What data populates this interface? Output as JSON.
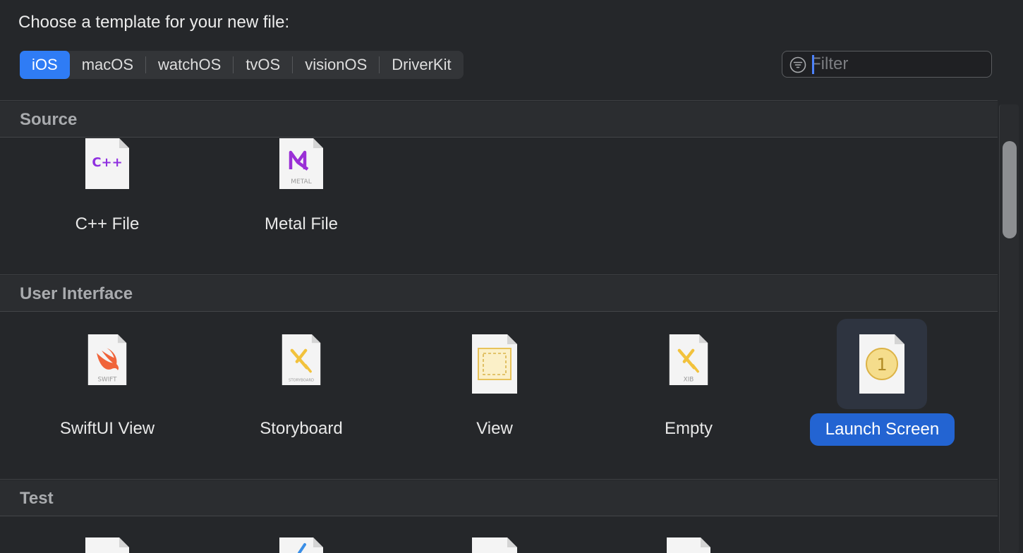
{
  "heading": "Choose a template for your new file:",
  "platforms": [
    {
      "label": "iOS",
      "active": true
    },
    {
      "label": "macOS",
      "active": false
    },
    {
      "label": "watchOS",
      "active": false
    },
    {
      "label": "tvOS",
      "active": false
    },
    {
      "label": "visionOS",
      "active": false
    },
    {
      "label": "DriverKit",
      "active": false
    }
  ],
  "filter": {
    "placeholder": "Filter",
    "value": ""
  },
  "sections": [
    {
      "title": "Source",
      "items": [
        {
          "label": "C++ File",
          "icon": "cpp-file-icon",
          "badge": "C++"
        },
        {
          "label": "Metal File",
          "icon": "metal-file-icon",
          "badge": "METAL"
        }
      ]
    },
    {
      "title": "User Interface",
      "items": [
        {
          "label": "SwiftUI View",
          "icon": "swift-file-icon",
          "badge": "SWIFT"
        },
        {
          "label": "Storyboard",
          "icon": "storyboard-file-icon",
          "badge": "STORYBOARD"
        },
        {
          "label": "View",
          "icon": "view-file-icon"
        },
        {
          "label": "Empty",
          "icon": "xib-file-icon",
          "badge": "XIB"
        },
        {
          "label": "Launch Screen",
          "icon": "launch-screen-file-icon",
          "badge": "1",
          "selected": true
        }
      ]
    },
    {
      "title": "Test",
      "items": []
    }
  ],
  "colors": {
    "accent": "#2f7cf5",
    "selection": "#2364d2",
    "background": "#25272a"
  }
}
